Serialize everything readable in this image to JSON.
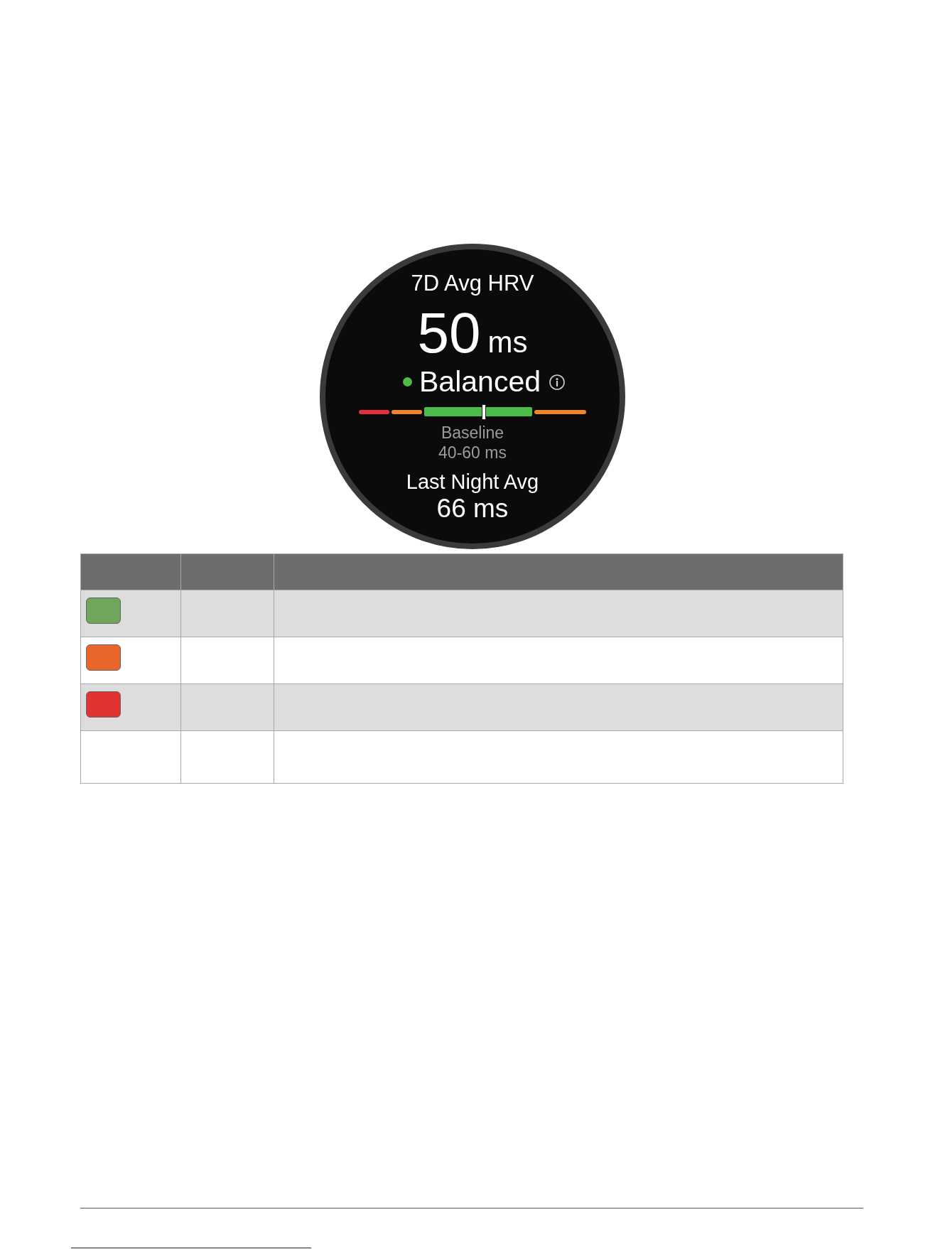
{
  "watch_face": {
    "title": "7D Avg HRV",
    "value": "50",
    "unit": "ms",
    "status": {
      "label": "Balanced",
      "color": "#4cbb4c"
    },
    "gauge": {
      "level": 0.55,
      "segments": [
        {
          "kind": "zone",
          "color": "#e6303f"
        },
        {
          "kind": "zone",
          "color": "#f0852a"
        },
        {
          "kind": "baseline",
          "color": "#4cbb4c"
        },
        {
          "kind": "zone",
          "color": "#f0852a"
        }
      ]
    },
    "baseline": {
      "label": "Baseline",
      "range": "40-60 ms"
    },
    "last_night": {
      "label": "Last Night Avg",
      "value": "66 ms"
    }
  },
  "table": {
    "rows": [
      {
        "kind": "swatch",
        "color": "#6fa65b"
      },
      {
        "kind": "swatch",
        "color": "#ea652b"
      },
      {
        "kind": "swatch",
        "color": "#e23232"
      },
      {
        "kind": "blank"
      }
    ]
  }
}
